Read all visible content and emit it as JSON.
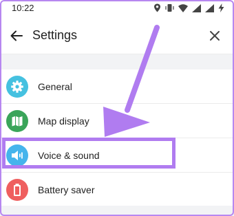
{
  "status_bar": {
    "time": "10:22"
  },
  "header": {
    "title": "Settings",
    "back_icon": "arrow-left-icon",
    "close_icon": "close-icon"
  },
  "settings": {
    "items": [
      {
        "label": "General",
        "icon": "gear-icon",
        "color": "#45c1e0"
      },
      {
        "label": "Map display",
        "icon": "map-icon",
        "color": "#3aa55a"
      },
      {
        "label": "Voice & sound",
        "icon": "speaker-icon",
        "color": "#45b4ec"
      },
      {
        "label": "Battery saver",
        "icon": "battery-icon",
        "color": "#ef5f5f"
      }
    ]
  },
  "colors": {
    "annotation": "#b07cf0"
  }
}
